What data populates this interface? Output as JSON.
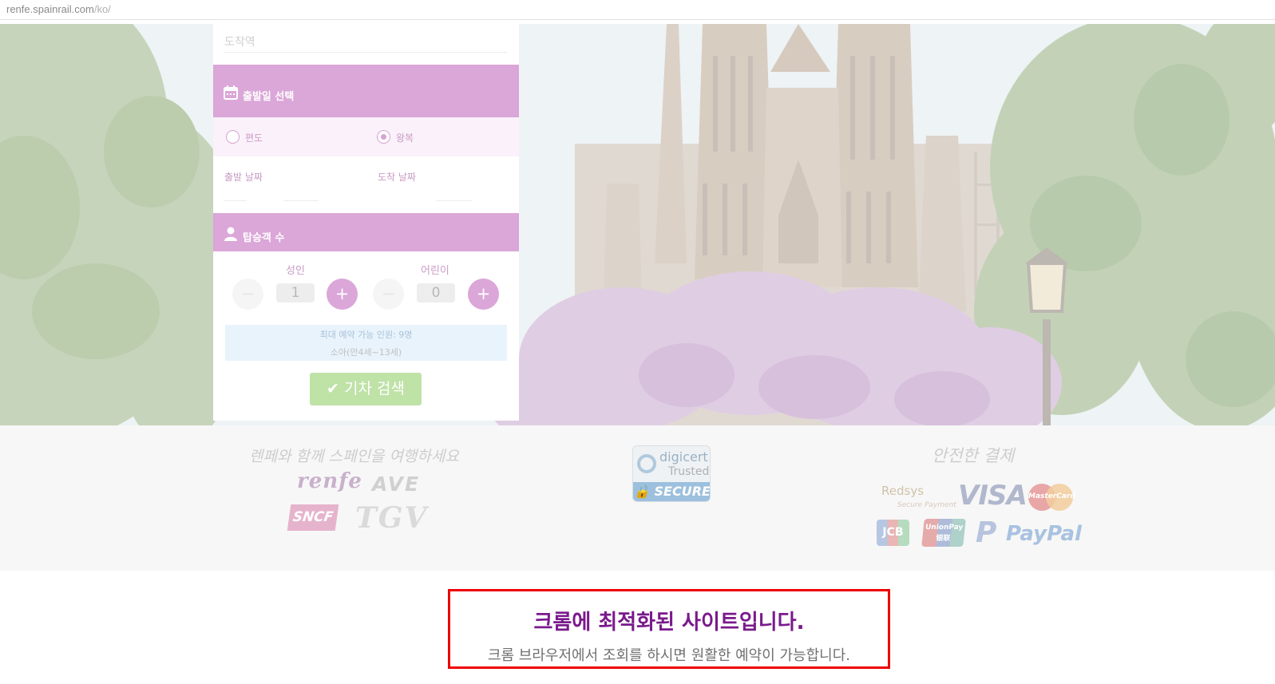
{
  "browser": {
    "url_host": "renfe.spainrail.com",
    "url_path": "/ko/"
  },
  "booking": {
    "destination_placeholder": "도착역",
    "date_section_title": "출발일 선택",
    "trip_type": {
      "one_way_label": "편도",
      "round_trip_label": "왕복",
      "selected": "왕복"
    },
    "departure_date_label": "출발 날짜",
    "arrival_date_label": "도착 날짜",
    "passenger_section_title": "탑승객 수",
    "adults": {
      "label": "성인",
      "value": "1"
    },
    "children": {
      "label": "어린이",
      "value": "0"
    },
    "minus_symbol": "−",
    "plus_symbol": "+",
    "info_line1": "최대 예약 가능 인원: 9명",
    "info_line2": "소아(만4세~13세)",
    "search_button": "✔ 기차 검색"
  },
  "footer": {
    "slogan": "렌페와 함께 스페인을 여행하세요",
    "secure_payment_title": "안전한 결제",
    "rail_logos": [
      "renfe",
      "AVE",
      "SNCF",
      "TGV"
    ],
    "digicert": {
      "line1": "digicert",
      "line2": "Trusted",
      "badge": "🔒 SECURE"
    },
    "payment_logos": {
      "redsys": "Redsys",
      "redsys_sub": "Secure Payment",
      "visa": "VISA",
      "mastercard": "MasterCard",
      "jcb": "JCB",
      "unionpay": "UnionPay 银联",
      "paypal_mark": "P",
      "paypal": "PayPal"
    }
  },
  "notice": {
    "title": "크롬에 최적화된 사이트입니다.",
    "subtitle": "크롬 브라우저에서 조회를 하시면 원활한 예약이 가능합니다."
  },
  "colors": {
    "section_header": "#dba6d8",
    "search_button": "#bfe2a7",
    "notice_border": "#ee0000",
    "notice_title": "#7a1a8c"
  }
}
